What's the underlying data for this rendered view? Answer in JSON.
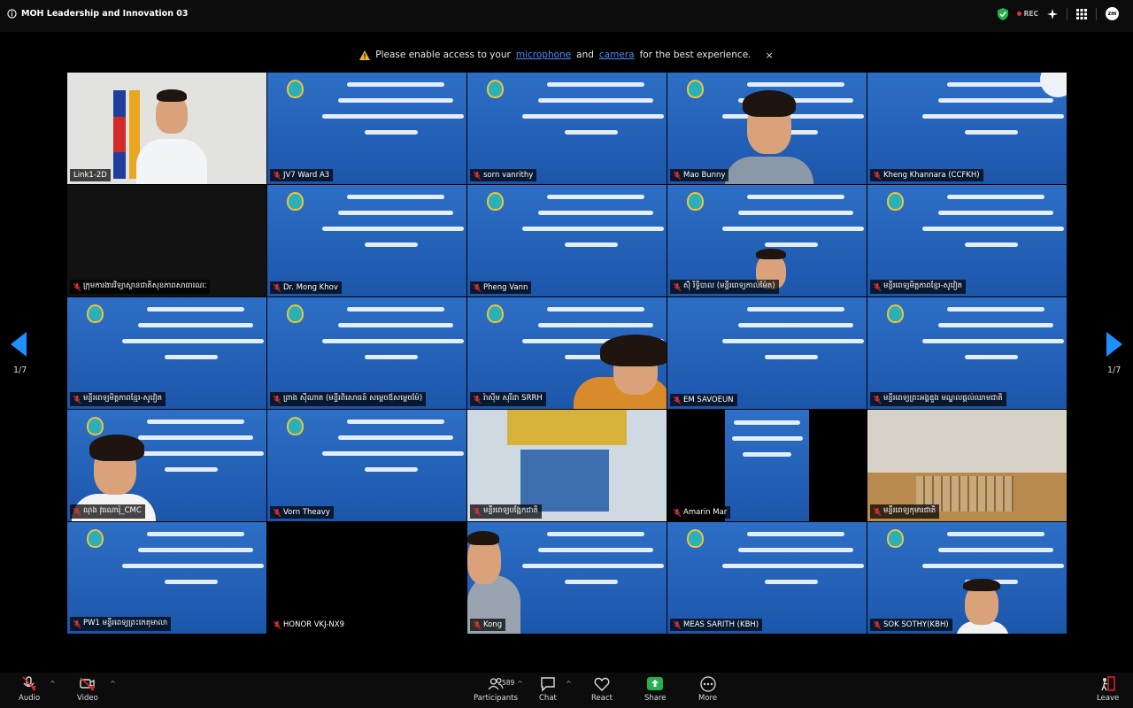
{
  "window": {
    "title": "MOH Leadership and Innovation 03",
    "rec_label": "REC",
    "avatar_label": "zm"
  },
  "banner": {
    "text_before": "Please enable access to your",
    "link_microphone": "microphone",
    "text_and": "and",
    "link_camera": "camera",
    "text_after": "for the best experience.",
    "close": "×"
  },
  "pagination": {
    "left_label": "1/7",
    "right_label": "1/7"
  },
  "participants": [
    {
      "name": "Link1-2D",
      "muted": false
    },
    {
      "name": "JV7 Ward A3",
      "muted": true
    },
    {
      "name": "sorn vanrithy",
      "muted": true
    },
    {
      "name": "Mao Bunny",
      "muted": true
    },
    {
      "name": "Kheng Khannara (CCFKH)",
      "muted": true
    },
    {
      "name": "ក្រុមការងារវិទ្យាស្ថានជាតិសុខភាពសាធារណៈ",
      "muted": true
    },
    {
      "name": "Dr. Mong Khov",
      "muted": true
    },
    {
      "name": "Pheng Vann",
      "muted": true
    },
    {
      "name": "ស៊ុំ រិទ្ធិបាល (មន្ទីរពេទ្យកាល់ម៉ែត)",
      "muted": true
    },
    {
      "name": "មន្ទីរពេទ្យមិត្តភាពខ្មែរ-សូវៀត",
      "muted": true
    },
    {
      "name": "មន្ទីរពេទ្យមិត្តភាពខ្មែរ-សូវៀត",
      "muted": true
    },
    {
      "name": "ព្រាង ស៊ីណាត (មន្ទីរពិសោធន៍ សម្ដេចឪសម្ដេចម៉ែ)",
      "muted": true
    },
    {
      "name": "រ៉ាស៊ីម សុរីដា SRRH",
      "muted": true
    },
    {
      "name": "EM SAVOEUN",
      "muted": true
    },
    {
      "name": "មន្ទីរពេទ្យព្រះអង្គឌួង មណ្ឌលផ្តល់ឈាមជាតិ",
      "muted": true
    },
    {
      "name": "ណុង វុធណារ៉ុ_CMC",
      "muted": true
    },
    {
      "name": "Vorn Theavy",
      "muted": true
    },
    {
      "name": "មន្ទីរពេទ្យបង្អែកជាតិ",
      "muted": true
    },
    {
      "name": "Amarin Mar",
      "muted": true
    },
    {
      "name": "មន្ទីរពេទ្យកុមារជាតិ",
      "muted": true
    },
    {
      "name": "PW1 មន្ទីរពេទ្យព្រះកេតុមាលា",
      "muted": true
    },
    {
      "name": "HONOR VKJ-NX9",
      "muted": true
    },
    {
      "name": "Kong",
      "muted": true
    },
    {
      "name": "MEAS SARITH (KBH)",
      "muted": true
    },
    {
      "name": "SOK SOTHY(KBH)",
      "muted": true
    }
  ],
  "toolbar": {
    "audio": "Audio",
    "video": "Video",
    "participants": "Participants",
    "participants_count": "589",
    "chat": "Chat",
    "react": "React",
    "share": "Share",
    "more": "More",
    "leave": "Leave"
  },
  "colors": {
    "tile_blue": "#1f5fb8",
    "active_border": "#57b45a",
    "link": "#4e8bff",
    "share_green": "#22b14c",
    "leave_red": "#e02424"
  }
}
